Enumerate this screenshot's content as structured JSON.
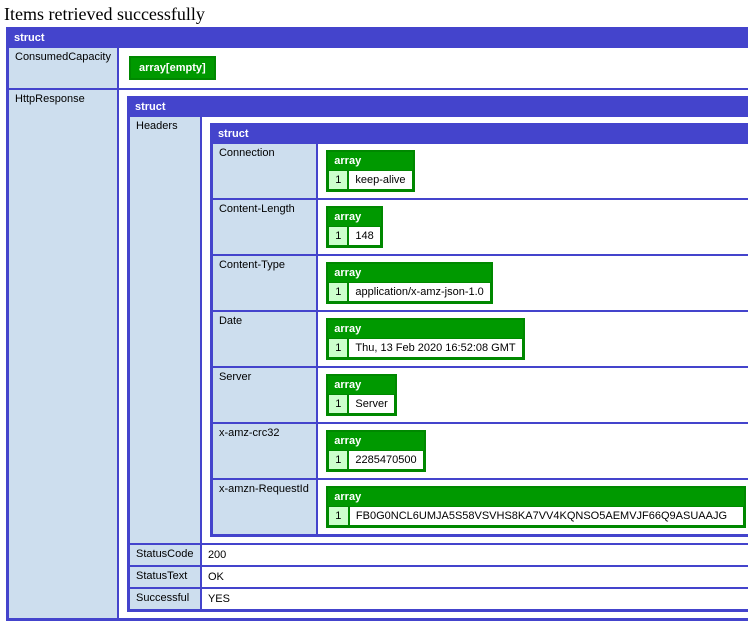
{
  "title": "Items retrieved successfully",
  "labels": {
    "struct": "struct",
    "array": "array",
    "arrayEmpty": "array[empty]"
  },
  "root": {
    "keys": {
      "ConsumedCapacity": "ConsumedCapacity",
      "HttpResponse": "HttpResponse"
    },
    "ConsumedCapacity": {
      "type": "array-empty"
    },
    "HttpResponse": {
      "keys": {
        "Headers": "Headers",
        "StatusCode": "StatusCode",
        "StatusText": "StatusText",
        "Successful": "Successful"
      },
      "Headers": {
        "keys": {
          "Connection": "Connection",
          "ContentLength": "Content-Length",
          "ContentType": "Content-Type",
          "Date": "Date",
          "Server": "Server",
          "xAmzCrc32": "x-amz-crc32",
          "xAmznRequestId": "x-amzn-RequestId"
        },
        "Connection": {
          "idx": "1",
          "val": "keep-alive"
        },
        "ContentLength": {
          "idx": "1",
          "val": "148"
        },
        "ContentType": {
          "idx": "1",
          "val": "application/x-amz-json-1.0"
        },
        "Date": {
          "idx": "1",
          "val": "Thu, 13 Feb 2020 16:52:08 GMT"
        },
        "Server": {
          "idx": "1",
          "val": "Server"
        },
        "xAmzCrc32": {
          "idx": "1",
          "val": "2285470500"
        },
        "xAmznRequestId": {
          "idx": "1",
          "val": "FB0G0NCL6UMJA5S58VSVHS8KA7VV4KQNSO5AEMVJF66Q9ASUAAJG"
        }
      },
      "StatusCode": "200",
      "StatusText": "OK",
      "Successful": "YES"
    }
  }
}
